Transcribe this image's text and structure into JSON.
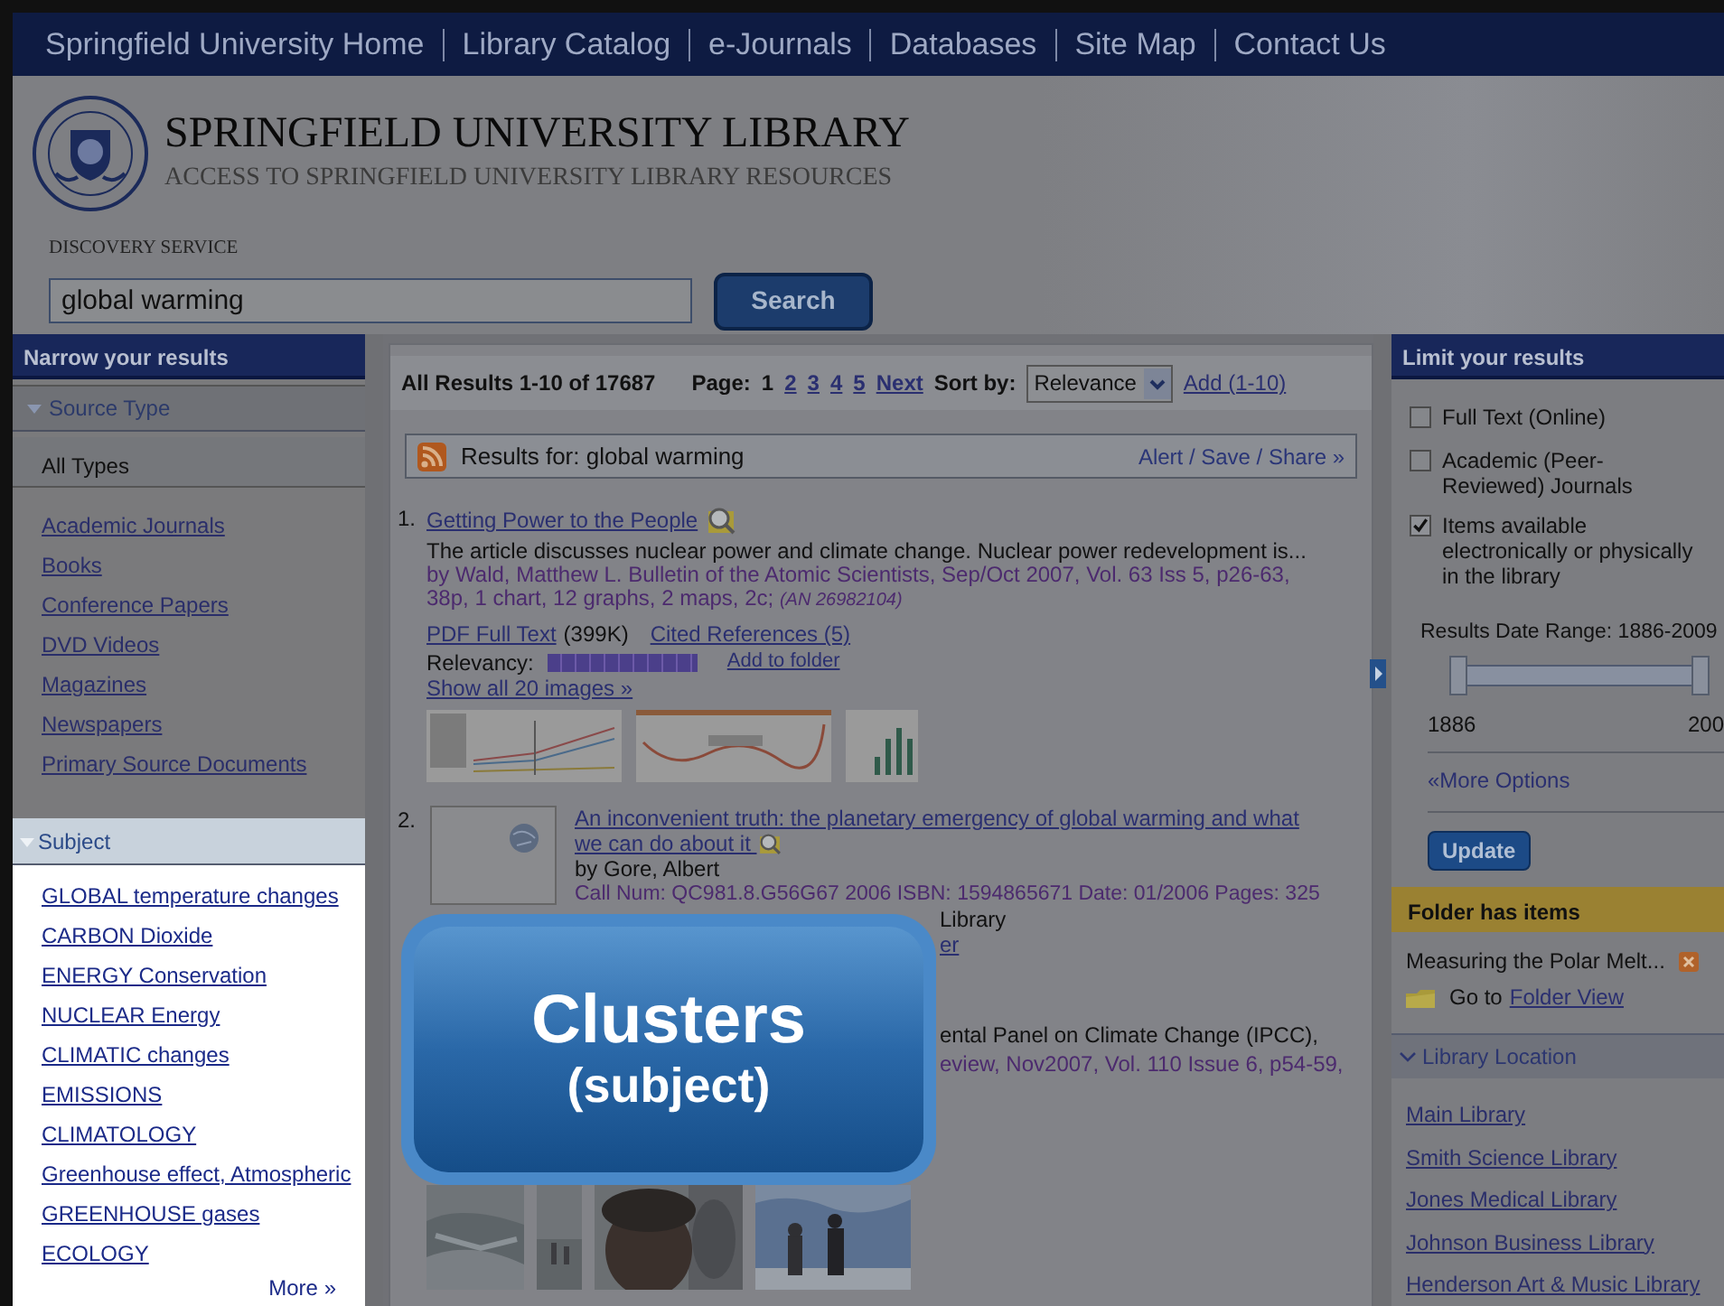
{
  "top_nav": {
    "links": [
      "Springfield University Home",
      "Library Catalog",
      "e-Journals",
      "Databases",
      "Site Map",
      "Contact Us"
    ]
  },
  "header": {
    "title": "SPRINGFIELD UNIVERSITY LIBRARY",
    "subtitle": "ACCESS TO SPRINGFIELD UNIVERSITY LIBRARY RESOURCES",
    "service_label": "DISCOVERY SERVICE",
    "search": {
      "value": "global warming"
    },
    "search_button": "Search"
  },
  "left": {
    "title": "Narrow your results",
    "source_type": {
      "label": "Source Type",
      "all": "All Types",
      "items": [
        "Academic Journals",
        "Books",
        "Conference Papers",
        "DVD Videos",
        "Magazines",
        "Newspapers",
        "Primary Source Documents"
      ]
    },
    "subject": {
      "label": "Subject",
      "items": [
        "GLOBAL temperature changes",
        "CARBON Dioxide",
        "ENERGY Conservation",
        "NUCLEAR Energy",
        "CLIMATIC changes",
        "EMISSIONS",
        "CLIMATOLOGY",
        "Greenhouse effect, Atmospheric",
        "GREENHOUSE gases",
        "ECOLOGY"
      ],
      "more": "More »"
    }
  },
  "results": {
    "summary": "All Results 1-10 of 17687",
    "page_label": "Page:",
    "pages": [
      {
        "label": "1",
        "selected": true
      },
      {
        "label": "2",
        "selected": false
      },
      {
        "label": "3",
        "selected": false
      },
      {
        "label": "4",
        "selected": false
      },
      {
        "label": "5",
        "selected": false
      }
    ],
    "next": "Next",
    "sort_label": "Sort by:",
    "sort_value": "Relevance",
    "add": "Add (1-10)",
    "results_for": "Results for: global warming",
    "alert": "Alert / Save / Share »",
    "items": [
      {
        "kind": "article",
        "number": "1.",
        "title": "Getting Power to the People",
        "abstract": "The article discusses nuclear power and climate change. Nuclear power redevelopment is...",
        "source": "by Wald, Matthew L. Bulletin of the Atomic Scientists, Sep/Oct 2007, Vol. 63 Iss 5, p26-63, 38p, 1 chart, 12 graphs, 2 maps, 2c;",
        "an": "(AN 26982104)",
        "pdf": "PDF Full Text",
        "size": "(399K)",
        "cited": "Cited References (5)",
        "relevancy_label": "Relevancy:",
        "level": 1,
        "add_folder": "Add to folder",
        "show_images": "Show all 20 images »"
      },
      {
        "kind": "book",
        "number": "2.",
        "title": "An inconvenient truth: the planetary emergency of global warming and what we can do about it",
        "author": "by Gore, Albert",
        "details": "Call Num: QC981.8.G56G67 2006 ISBN: 1594865671 Date: 01/2006 Pages: 325",
        "location_fragment": "Library",
        "link_fragment": "er"
      },
      {
        "kind": "partial",
        "line_1": "ental Panel on Climate Change (IPCC),",
        "line_2": "eview, Nov2007, Vol. 110 Issue 6, p54-59,"
      }
    ]
  },
  "callout": {
    "title": "Clusters",
    "subtitle": "(subject)"
  },
  "right": {
    "title": "Limit your results",
    "options": [
      {
        "label": "Full Text (Online)",
        "checked": false
      },
      {
        "label": "Academic (Peer-Reviewed) Journals",
        "checked": false
      },
      {
        "label": "Items available electronically or physically in the library",
        "checked": true
      }
    ],
    "date_range": {
      "label": "Results Date Range: 1886-2009",
      "level": 1,
      "min": "1886",
      "max": "200"
    },
    "more_options": "«More Options",
    "update": "Update",
    "folder": {
      "title": "Folder has items",
      "items": [
        "Measuring the Polar Melt..."
      ],
      "go_to": "Go to",
      "folder_view": "Folder View"
    },
    "location": {
      "label": "Library Location",
      "items": [
        "Main Library",
        "Smith Science Library",
        "Jones Medical Library",
        "Johnson Business Library",
        "Henderson Art & Music Library"
      ]
    }
  }
}
